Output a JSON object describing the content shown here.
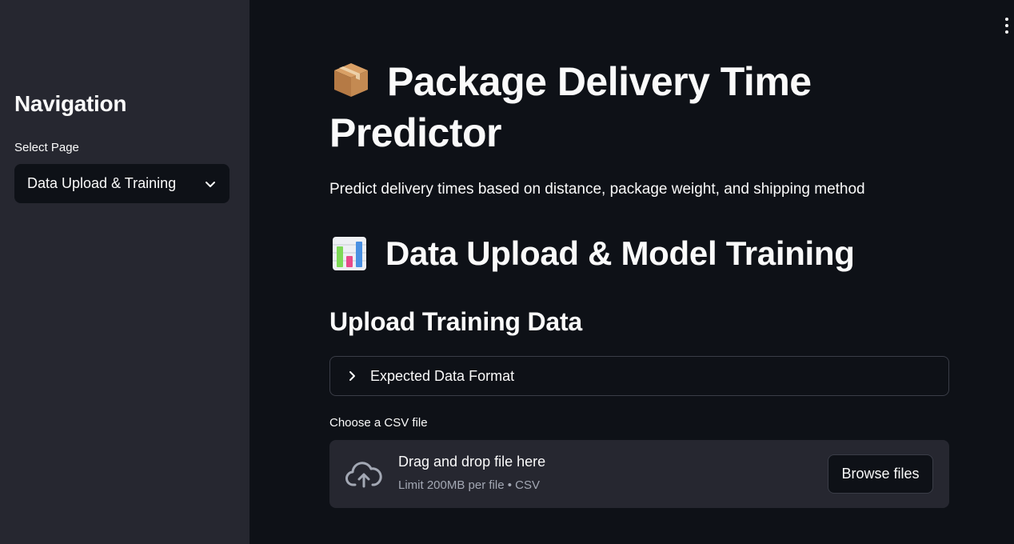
{
  "sidebar": {
    "title": "Navigation",
    "select_label": "Select Page",
    "selected_page": "Data Upload & Training"
  },
  "main": {
    "title": "Package Delivery Time Predictor",
    "title_icon": "package-box-icon",
    "subtitle": "Predict delivery times based on distance, package weight, and shipping method",
    "section_title": "Data Upload & Model Training",
    "section_icon": "bar-chart-icon",
    "subsection_title": "Upload Training Data",
    "expander_label": "Expected Data Format",
    "uploader": {
      "label": "Choose a CSV file",
      "drop_text": "Drag and drop file here",
      "limit_text": "Limit 200MB per file • CSV",
      "browse_label": "Browse files",
      "icon": "cloud-upload-icon"
    }
  },
  "colors": {
    "background": "#0e1117",
    "sidebar": "#262730",
    "text": "#fafafa",
    "muted": "#a3a8b4",
    "border": "#3a3d47"
  }
}
